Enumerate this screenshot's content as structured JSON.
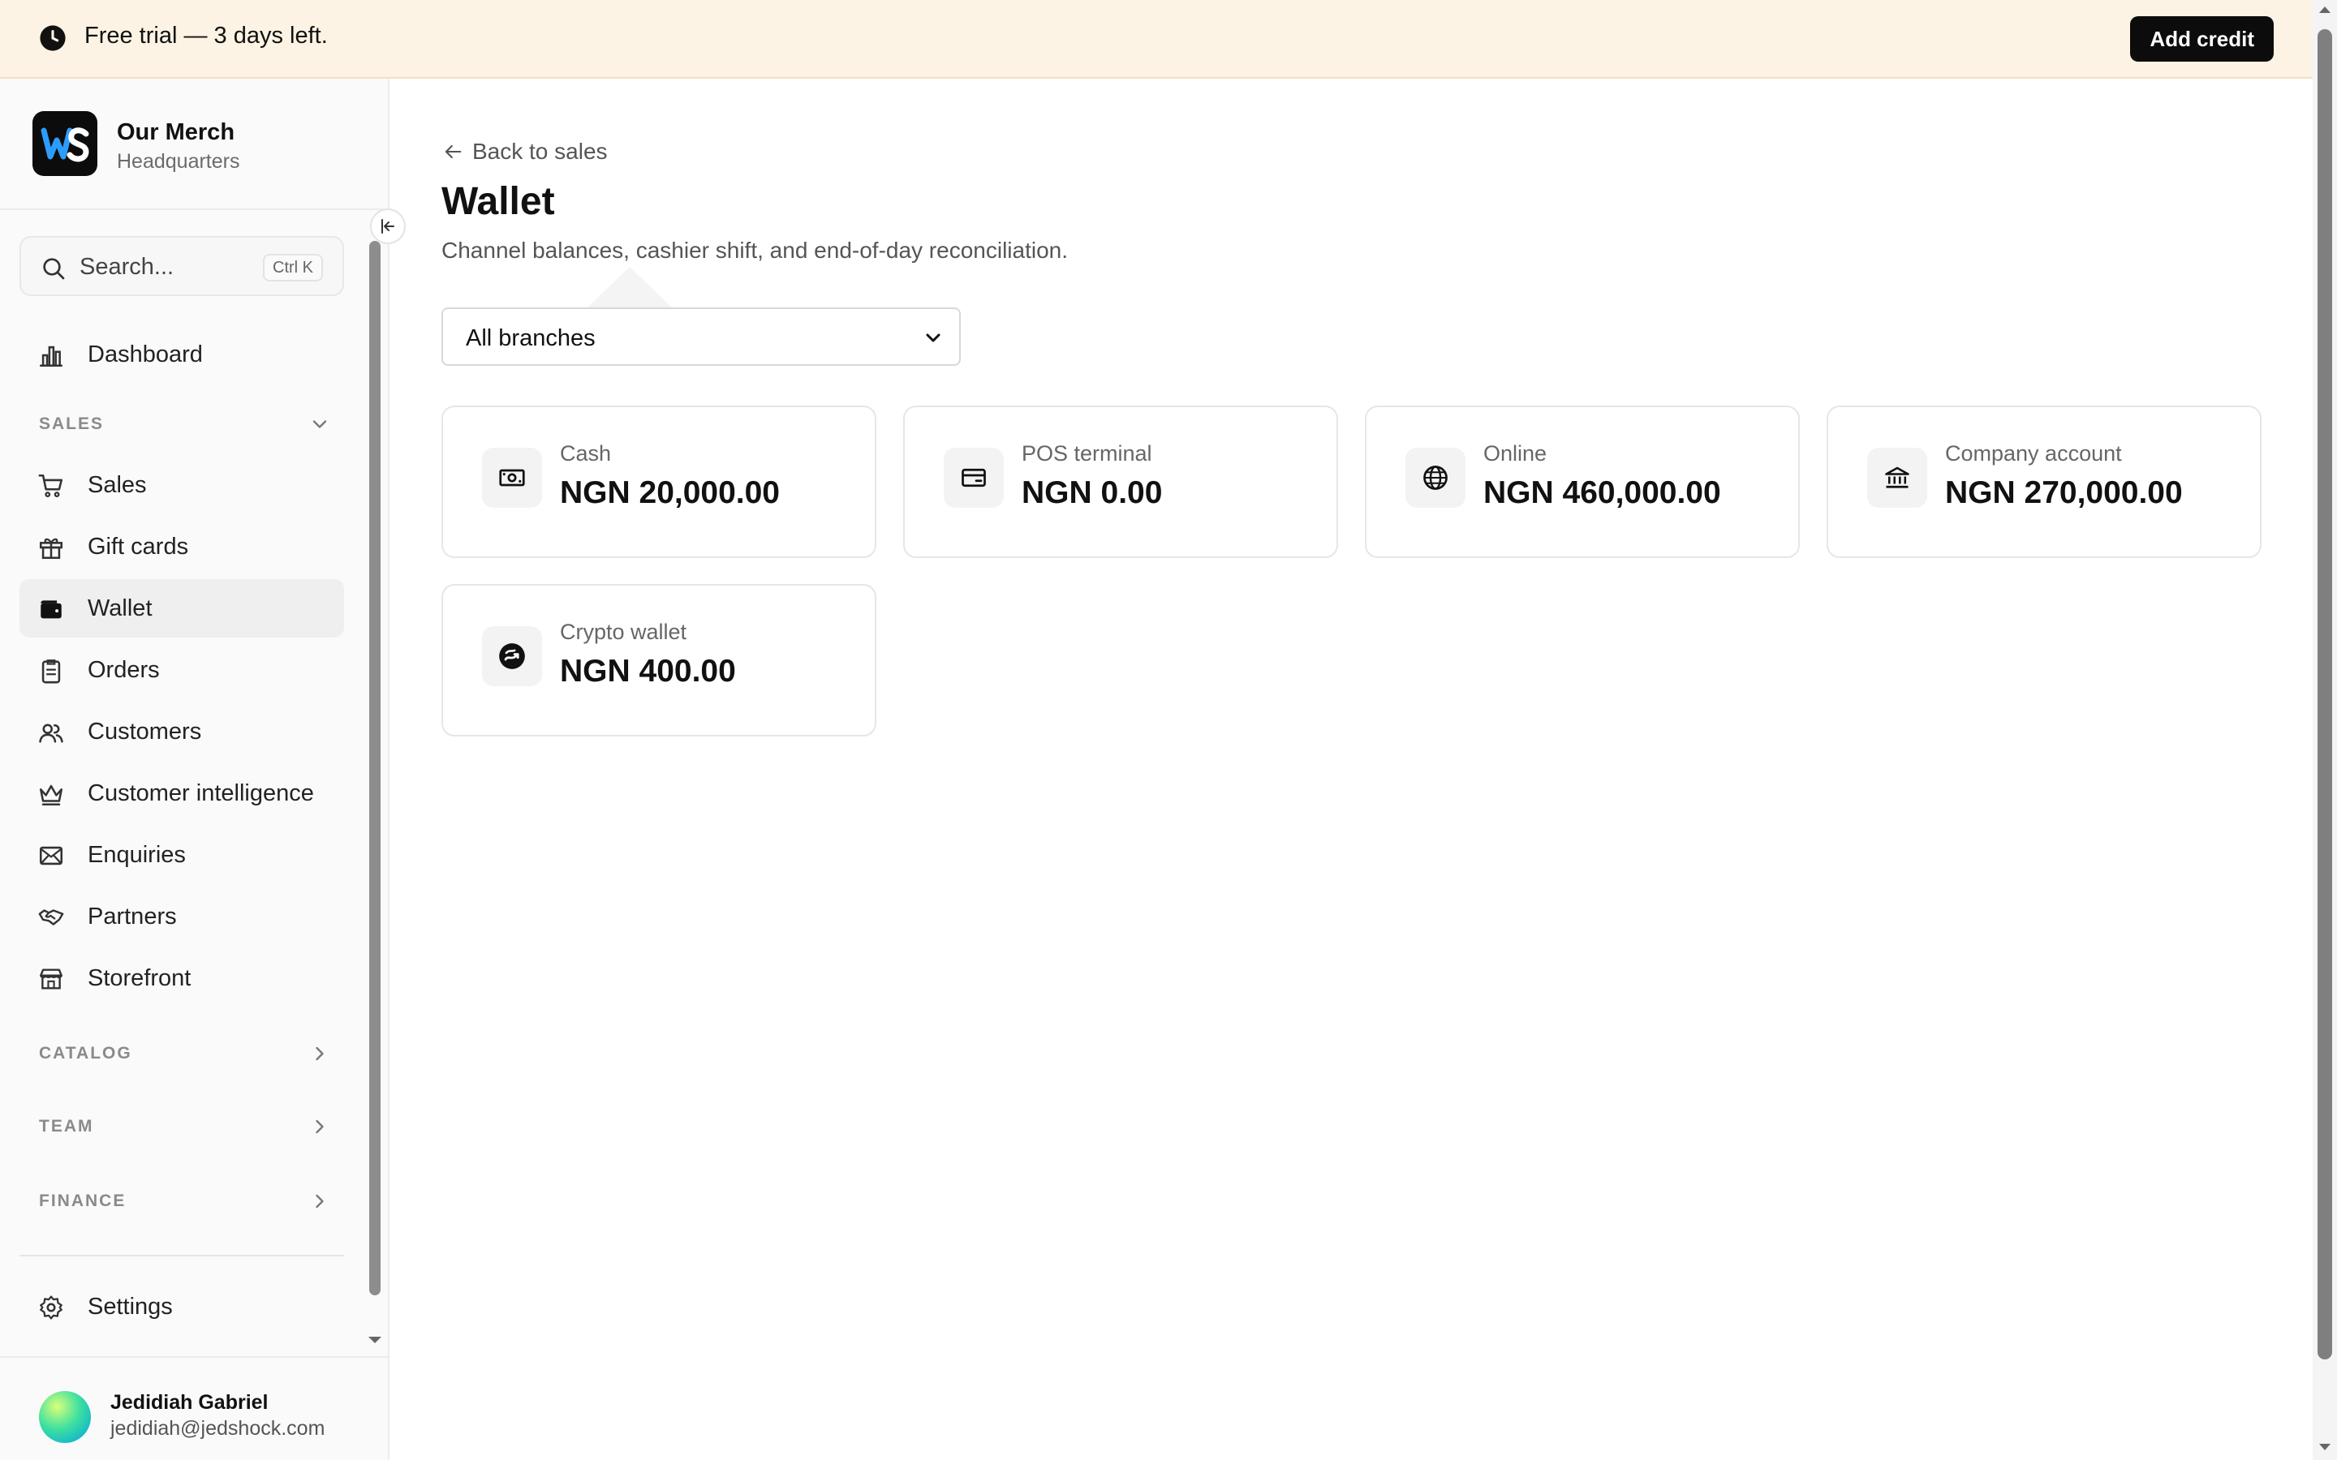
{
  "banner": {
    "text": "Free trial — 3 days left.",
    "button_label": "Add credit",
    "icon": "clock-icon"
  },
  "brand": {
    "name": "Our Merch",
    "subtitle": "Headquarters",
    "logo_text": "WS"
  },
  "search": {
    "placeholder": "Search...",
    "shortcut": "Ctrl K"
  },
  "nav": {
    "dashboard": "Dashboard",
    "sales_section": "SALES",
    "items": [
      {
        "label": "Sales",
        "icon": "cart-icon"
      },
      {
        "label": "Gift cards",
        "icon": "gift-icon"
      },
      {
        "label": "Wallet",
        "icon": "wallet-icon",
        "active": true
      },
      {
        "label": "Orders",
        "icon": "clipboard-icon"
      },
      {
        "label": "Customers",
        "icon": "users-icon"
      },
      {
        "label": "Customer intelligence",
        "icon": "crown-icon"
      },
      {
        "label": "Enquiries",
        "icon": "mail-icon"
      },
      {
        "label": "Partners",
        "icon": "handshake-icon"
      },
      {
        "label": "Storefront",
        "icon": "store-icon"
      }
    ],
    "sections": [
      "CATALOG",
      "TEAM",
      "FINANCE"
    ],
    "settings": "Settings"
  },
  "user": {
    "name": "Jedidiah Gabriel",
    "email": "jedidiah@jedshock.com"
  },
  "page": {
    "back_label": "Back to sales",
    "title": "Wallet",
    "subtitle": "Channel balances, cashier shift, and end-of-day reconciliation.",
    "branch_selected": "All branches"
  },
  "balances": [
    {
      "label": "Cash",
      "value": "NGN 20,000.00",
      "icon": "banknote-icon"
    },
    {
      "label": "POS terminal",
      "value": "NGN 0.00",
      "icon": "credit-card-icon"
    },
    {
      "label": "Online",
      "value": "NGN 460,000.00",
      "icon": "globe-icon"
    },
    {
      "label": "Company account",
      "value": "NGN 270,000.00",
      "icon": "bank-icon"
    },
    {
      "label": "Crypto wallet",
      "value": "NGN 400.00",
      "icon": "crypto-icon"
    }
  ],
  "colors": {
    "banner_bg": "#fdf3e4",
    "primary_button": "#0c0c0c",
    "active_nav_bg": "#efefef"
  }
}
